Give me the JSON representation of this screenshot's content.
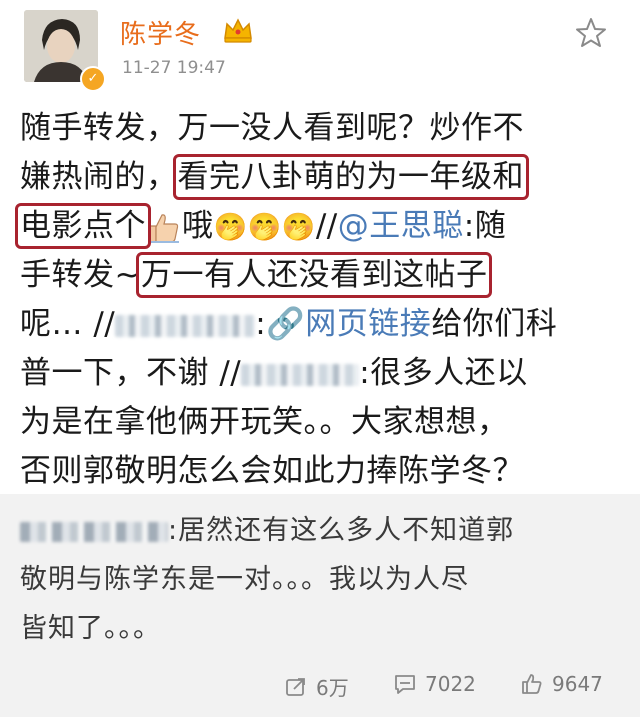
{
  "post": {
    "author": "陈学冬",
    "timestamp": "11-27 19:47",
    "lines": [
      {
        "segments": [
          {
            "t": "随手转发，万一没人看到呢？炒作不"
          }
        ]
      },
      {
        "segments": [
          {
            "t": "嫌热闹的，"
          },
          {
            "t": "看完八卦萌的为一年级和",
            "hl": true
          }
        ]
      },
      {
        "segments": [
          {
            "t": "电影点个",
            "hl": true
          },
          {
            "thumb": true
          },
          {
            "t": "哦"
          },
          {
            "emoji": "🤭🤭🤭"
          },
          {
            "t": "//"
          },
          {
            "t": "@王思聪",
            "mention": true
          },
          {
            "t": ":随"
          }
        ]
      },
      {
        "segments": [
          {
            "t": "手转发~"
          },
          {
            "t": "万一有人还没看到这帖子",
            "hl": true
          }
        ]
      },
      {
        "segments": [
          {
            "t": "呢… //"
          },
          {
            "blur": "long"
          },
          {
            "t": ":"
          },
          {
            "t": "🔗网页链接",
            "link": true
          },
          {
            "t": "给你们科"
          }
        ]
      },
      {
        "segments": [
          {
            "t": "普一下，不谢 //"
          },
          {
            "blur": "short"
          },
          {
            "t": ":很多人还以"
          }
        ]
      },
      {
        "segments": [
          {
            "t": "为是在拿他俩开玩笑。。大家想想，"
          }
        ]
      },
      {
        "segments": [
          {
            "t": "否则郭敬明怎么会如此力捧陈学冬？"
          }
        ]
      }
    ]
  },
  "repost": {
    "lines": [
      "居然还有这么多人不知道郭",
      "敬明与陈学东是一对。。。我以为人尽",
      "皆知了。。。"
    ]
  },
  "actions": {
    "reposts": "6万",
    "comments": "7022",
    "likes": "9647"
  },
  "colors": {
    "username": "#e86d1c",
    "link": "#4a7bb7",
    "highlight_box": "#a8232f",
    "repost_bg": "#f2f2f2"
  },
  "icons": [
    "crown-icon",
    "star-icon",
    "verified-icon",
    "thumbs-up-emoji",
    "grin-emoji",
    "link-icon",
    "repost-icon",
    "comment-icon",
    "like-icon"
  ]
}
